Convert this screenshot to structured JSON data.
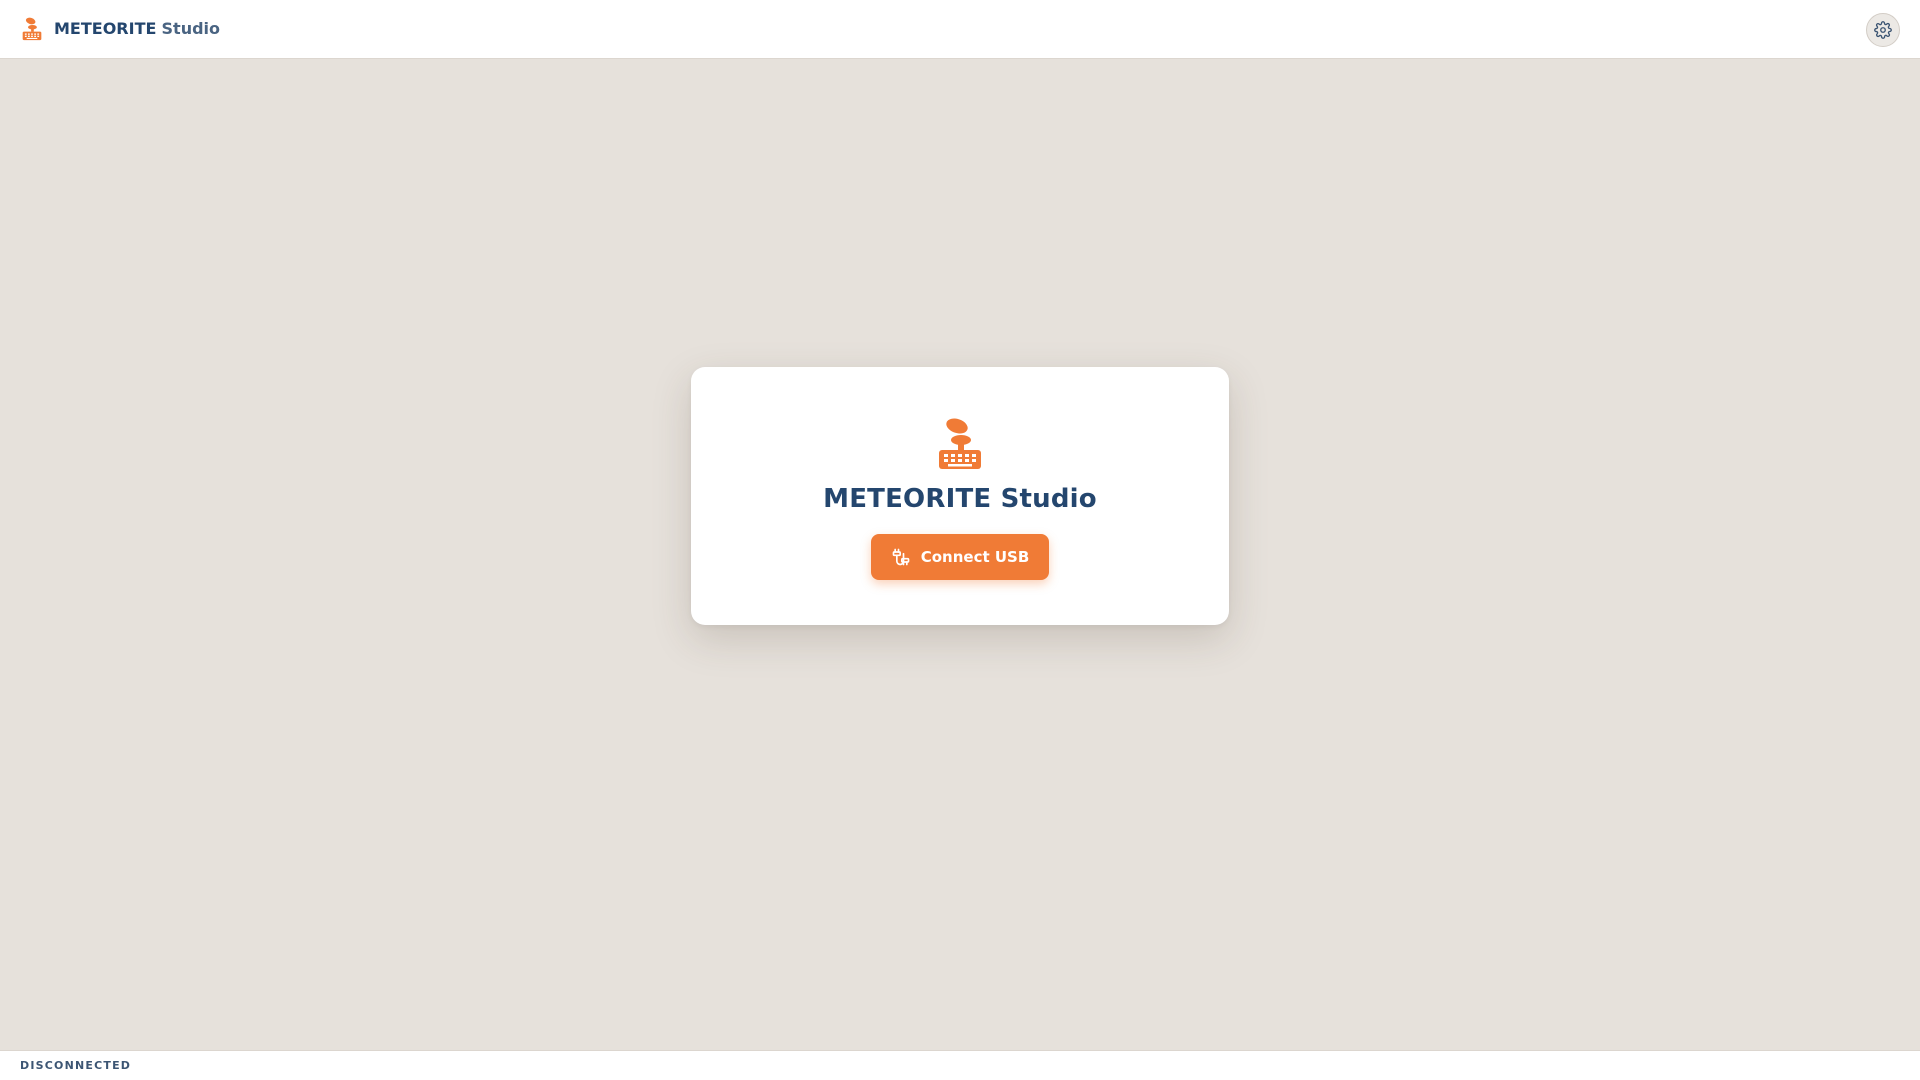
{
  "header": {
    "brand_name": "METEORITE",
    "brand_suffix": "Studio",
    "logo_icon": "meteorite-keyboard-icon",
    "settings_icon": "gear-icon"
  },
  "card": {
    "title": "METEORITE Studio",
    "logo_icon": "meteorite-keyboard-icon",
    "connect_label": "Connect USB",
    "connect_icon": "usb-cable-icon"
  },
  "footer": {
    "status": "DISCONNECTED"
  },
  "colors": {
    "accent": "#f07b36",
    "brand_text": "#24466e",
    "background": "#e6e1db",
    "surface": "#ffffff"
  }
}
